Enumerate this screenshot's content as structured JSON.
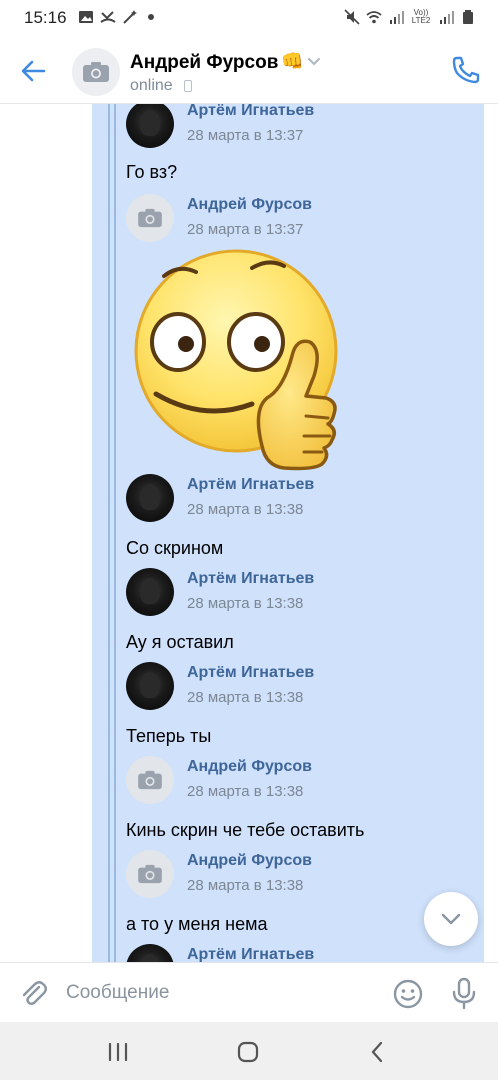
{
  "status_bar": {
    "time": "15:16",
    "lte": "Vo)) LTE2"
  },
  "header": {
    "name": "Андрей Фурсов",
    "name_emoji": "👊",
    "status": "online"
  },
  "messages": [
    {
      "author": "Артём Игнатьев",
      "time": "28 марта в 13:37",
      "avatar": "photo",
      "text": "Го вз?"
    },
    {
      "author": "Андрей Фурсов",
      "time": "28 марта в 13:37",
      "avatar": "camera",
      "sticker": "thumbs-up-smiley"
    },
    {
      "author": "Артём Игнатьев",
      "time": "28 марта в 13:38",
      "avatar": "photo",
      "text": "Со скрином"
    },
    {
      "author": "Артём Игнатьев",
      "time": "28 марта в 13:38",
      "avatar": "photo",
      "text": "Ау я оставил"
    },
    {
      "author": "Артём Игнатьев",
      "time": "28 марта в 13:38",
      "avatar": "photo",
      "text": "Теперь ты"
    },
    {
      "author": "Андрей Фурсов",
      "time": "28 марта в 13:38",
      "avatar": "camera",
      "text": "Кинь скрин че тебе оставить"
    },
    {
      "author": "Андрей Фурсов",
      "time": "28 марта в 13:38",
      "avatar": "camera",
      "text": "а то у меня нема"
    },
    {
      "author": "Артём Игнатьев",
      "avatar": "photo"
    }
  ],
  "composer": {
    "placeholder": "Сообщение"
  },
  "colors": {
    "accent": "#2a5885",
    "icon_blue": "#3f8ae0",
    "forward_bg": "#cfe1fb",
    "author_name": "#3f6699"
  }
}
